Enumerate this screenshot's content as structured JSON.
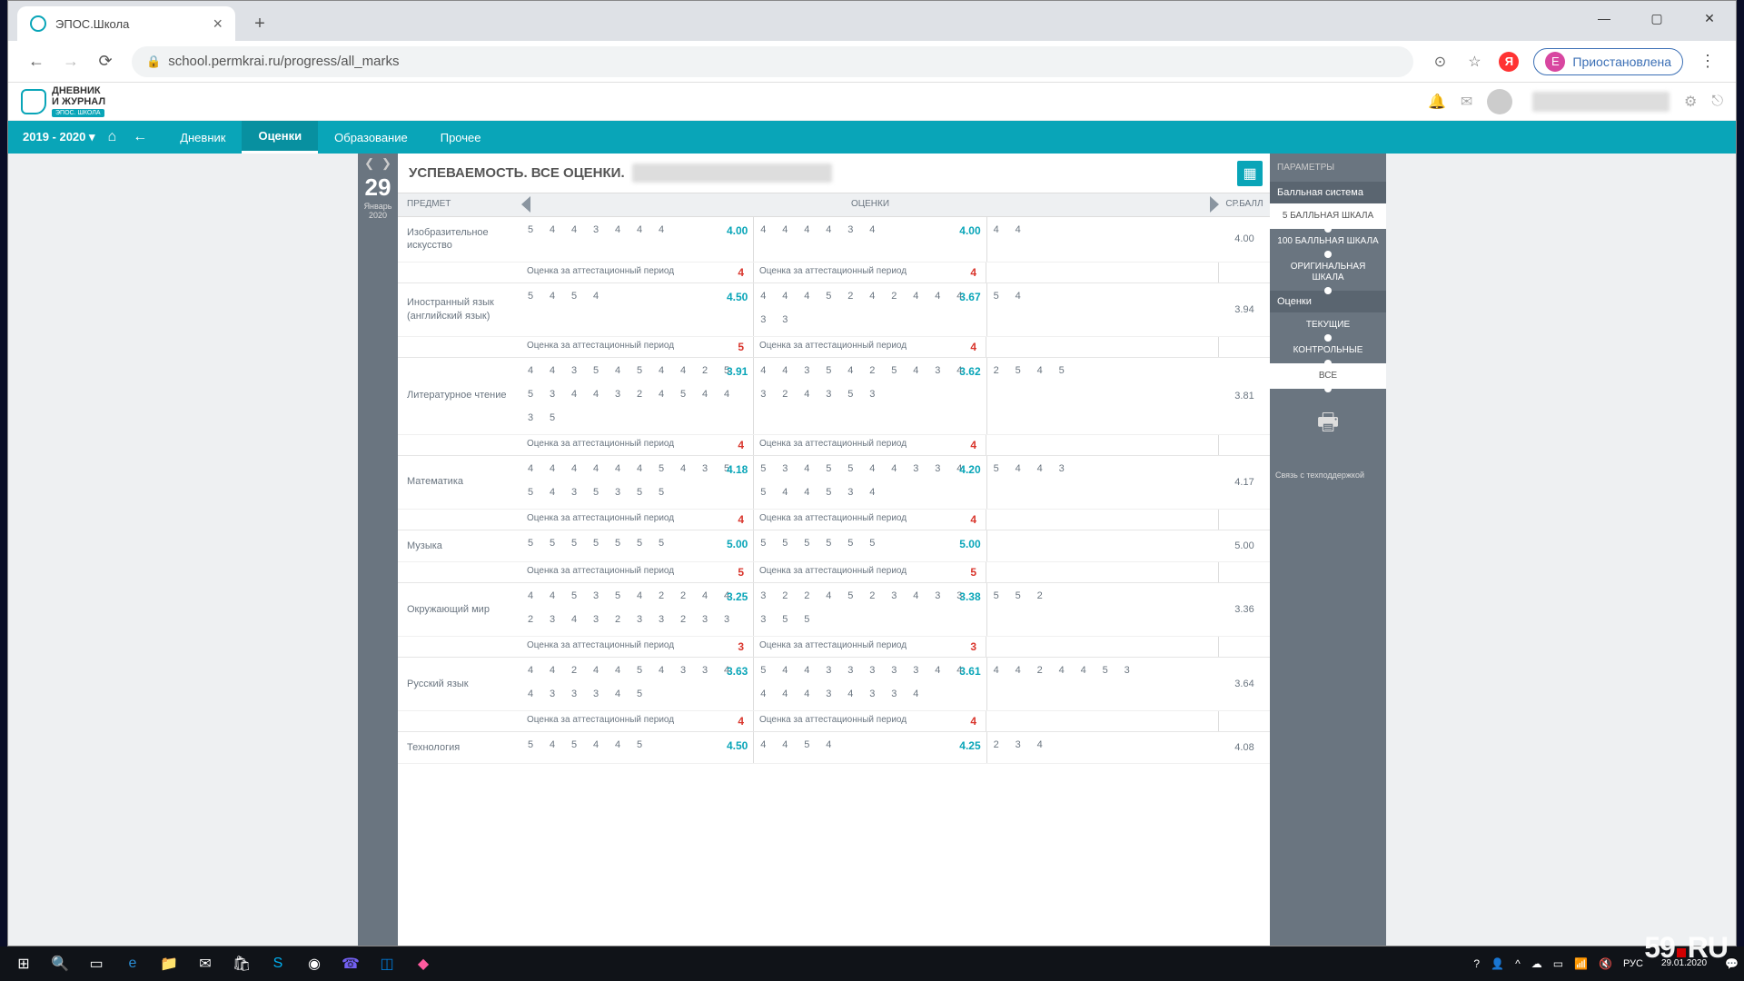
{
  "browser": {
    "tab_title": "ЭПОС.Школа",
    "url": "school.permkrai.ru/progress/all_marks",
    "profile_initial": "Е",
    "profile_status": "Приостановлена",
    "yandex": "Я"
  },
  "app_header": {
    "logo_line1": "ДНЕВНИК",
    "logo_line2": "И ЖУРНАЛ",
    "logo_badge": "ЭПОС. ШКОЛА"
  },
  "menu": {
    "year": "2019 - 2020 ▾",
    "items": [
      "Дневник",
      "Оценки",
      "Образование",
      "Прочее"
    ]
  },
  "date_col": {
    "day": "29",
    "month": "Январь",
    "year": "2020"
  },
  "page_title": "УСПЕВАЕМОСТЬ. ВСЕ ОЦЕНКИ.",
  "table_headers": {
    "subject": "ПРЕДМЕТ",
    "marks": "ОЦЕНКИ",
    "avg": "СР.БАЛЛ"
  },
  "attestation_label": "Оценка за аттестационный период",
  "subjects": [
    {
      "name": "Изобразительное искусство",
      "periods": [
        {
          "grades": [
            "5",
            "4",
            "4",
            "3",
            "4",
            "4",
            "4"
          ],
          "avg": "4.00",
          "att": "4"
        },
        {
          "grades": [
            "4",
            "4",
            "4",
            "4",
            "3",
            "4"
          ],
          "avg": "4.00",
          "att": "4"
        },
        {
          "grades": [
            "4",
            "4"
          ],
          "avg": "",
          "att": ""
        }
      ],
      "avg": "4.00"
    },
    {
      "name": "Иностранный язык (английский язык)",
      "periods": [
        {
          "grades": [
            "5",
            "4",
            "5",
            "4"
          ],
          "avg": "4.50",
          "att": "5"
        },
        {
          "grades": [
            "4",
            "4",
            "4",
            "5",
            "2",
            "4",
            "2",
            "4",
            "4",
            "4",
            "3",
            "3"
          ],
          "avg": "3.67",
          "att": "4"
        },
        {
          "grades": [
            "5",
            "4"
          ],
          "avg": "",
          "att": ""
        }
      ],
      "avg": "3.94"
    },
    {
      "name": "Литературное чтение",
      "periods": [
        {
          "grades": [
            "4",
            "4",
            "3",
            "5",
            "4",
            "5",
            "4",
            "4",
            "2",
            "5",
            "5",
            "3",
            "4",
            "4",
            "3",
            "2",
            "4",
            "5",
            "4",
            "4",
            "3",
            "5"
          ],
          "avg": "3.91",
          "att": "4"
        },
        {
          "grades": [
            "4",
            "4",
            "3",
            "5",
            "4",
            "2",
            "5",
            "4",
            "3",
            "4",
            "3",
            "2",
            "4",
            "3",
            "5",
            "3"
          ],
          "avg": "3.62",
          "att": "4"
        },
        {
          "grades": [
            "2",
            "5",
            "4",
            "5"
          ],
          "avg": "",
          "att": ""
        }
      ],
      "avg": "3.81"
    },
    {
      "name": "Математика",
      "periods": [
        {
          "grades": [
            "4",
            "4",
            "4",
            "4",
            "4",
            "4",
            "5",
            "4",
            "3",
            "5",
            "5",
            "4",
            "3",
            "5",
            "3",
            "5",
            "5"
          ],
          "avg": "4.18",
          "att": "4"
        },
        {
          "grades": [
            "5",
            "3",
            "4",
            "5",
            "5",
            "4",
            "4",
            "3",
            "3",
            "4",
            "5",
            "4",
            "4",
            "5",
            "3",
            "4"
          ],
          "avg": "4.20",
          "att": "4"
        },
        {
          "grades": [
            "5",
            "4",
            "4",
            "3"
          ],
          "avg": "",
          "att": ""
        }
      ],
      "avg": "4.17"
    },
    {
      "name": "Музыка",
      "periods": [
        {
          "grades": [
            "5",
            "5",
            "5",
            "5",
            "5",
            "5",
            "5"
          ],
          "avg": "5.00",
          "att": "5"
        },
        {
          "grades": [
            "5",
            "5",
            "5",
            "5",
            "5",
            "5"
          ],
          "avg": "5.00",
          "att": "5"
        },
        {
          "grades": [],
          "avg": "",
          "att": ""
        }
      ],
      "avg": "5.00"
    },
    {
      "name": "Окружающий мир",
      "periods": [
        {
          "grades": [
            "4",
            "4",
            "5",
            "3",
            "5",
            "4",
            "2",
            "2",
            "4",
            "4",
            "2",
            "3",
            "4",
            "3",
            "2",
            "3",
            "3",
            "2",
            "3",
            "3"
          ],
          "avg": "3.25",
          "att": "3"
        },
        {
          "grades": [
            "3",
            "2",
            "2",
            "4",
            "5",
            "2",
            "3",
            "4",
            "3",
            "3",
            "3",
            "5",
            "5"
          ],
          "avg": "3.38",
          "att": "3"
        },
        {
          "grades": [
            "5",
            "5",
            "2"
          ],
          "avg": "",
          "att": ""
        }
      ],
      "avg": "3.36"
    },
    {
      "name": "Русский язык",
      "periods": [
        {
          "grades": [
            "4",
            "4",
            "2",
            "4",
            "4",
            "5",
            "4",
            "3",
            "3",
            "4",
            "4",
            "3",
            "3",
            "3",
            "4",
            "5"
          ],
          "avg": "3.63",
          "att": "4"
        },
        {
          "grades": [
            "5",
            "4",
            "4",
            "3",
            "3",
            "3",
            "3",
            "3",
            "4",
            "4",
            "4",
            "4",
            "4",
            "3",
            "4",
            "3",
            "3",
            "4"
          ],
          "avg": "3.61",
          "att": "4"
        },
        {
          "grades": [
            "4",
            "4",
            "2",
            "4",
            "4",
            "5",
            "3"
          ],
          "avg": "",
          "att": ""
        }
      ],
      "avg": "3.64"
    },
    {
      "name": "Технология",
      "periods": [
        {
          "grades": [
            "5",
            "4",
            "5",
            "4",
            "4",
            "5"
          ],
          "avg": "4.50",
          "att": ""
        },
        {
          "grades": [
            "4",
            "4",
            "5",
            "4"
          ],
          "avg": "4.25",
          "att": ""
        },
        {
          "grades": [
            "2",
            "3",
            "4"
          ],
          "avg": "",
          "att": ""
        }
      ],
      "avg": "4.08"
    }
  ],
  "sidebar": {
    "params": "ПАРАМЕТРЫ",
    "scale_header": "Балльная система",
    "scales": [
      "5 БАЛЛЬНАЯ ШКАЛА",
      "100 БАЛЛЬНАЯ ШКАЛА",
      "ОРИГИНАЛЬНАЯ ШКАЛА"
    ],
    "marks_header": "Оценки",
    "mark_filters": [
      "ТЕКУЩИЕ",
      "КОНТРОЛЬНЫЕ",
      "ВСЕ"
    ],
    "support": "Связь с техподдержкой"
  },
  "taskbar": {
    "time": "",
    "date": "29.01.2020"
  },
  "watermark": {
    "num": "59",
    "dot": ".",
    "ru": "RU"
  }
}
